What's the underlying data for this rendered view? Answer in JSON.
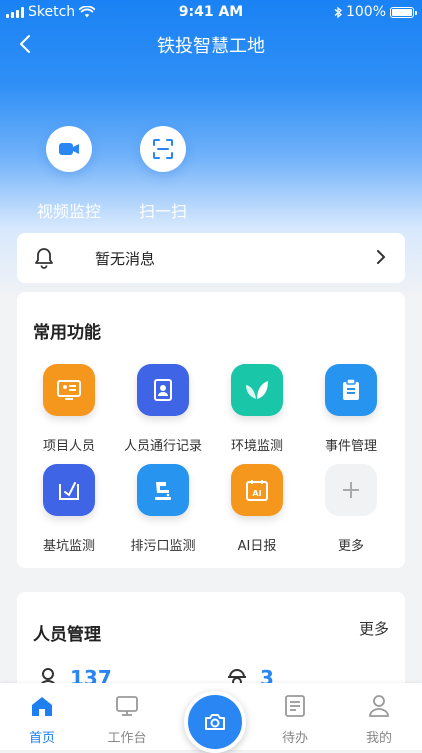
{
  "status": {
    "carrier": "Sketch",
    "time": "9:41 AM",
    "battery": "100%"
  },
  "header": {
    "title": "铁投智慧工地"
  },
  "quick_actions": [
    {
      "label": "视频监控",
      "icon": "video-camera-icon"
    },
    {
      "label": "扫一扫",
      "icon": "scan-icon"
    }
  ],
  "notice": {
    "text": "暂无消息"
  },
  "common": {
    "title": "常用功能",
    "items": [
      {
        "label": "项目人员",
        "icon": "project-staff-icon",
        "color": "#f5961d"
      },
      {
        "label": "人员通行记录",
        "icon": "access-record-icon",
        "color": "#3f64e6"
      },
      {
        "label": "环境监测",
        "icon": "leaf-icon",
        "color": "#19c6a7"
      },
      {
        "label": "事件管理",
        "icon": "clipboard-icon",
        "color": "#2795f0"
      },
      {
        "label": "基坑监测",
        "icon": "foundation-pit-icon",
        "color": "#3f64e6"
      },
      {
        "label": "排污口监测",
        "icon": "outfall-icon",
        "color": "#2795f0"
      },
      {
        "label": "AI日报",
        "icon": "ai-calendar-icon",
        "color": "#f5961d"
      },
      {
        "label": "更多",
        "icon": "plus-icon",
        "color": "#f1f2f4"
      }
    ]
  },
  "personnel": {
    "title": "人员管理",
    "more": "更多",
    "stats": [
      {
        "value": "137",
        "icon": "person-icon"
      },
      {
        "value": "3",
        "icon": "helmet-worker-icon"
      }
    ]
  },
  "tabs": [
    {
      "label": "首页",
      "icon": "home-icon"
    },
    {
      "label": "工作台",
      "icon": "monitor-icon"
    },
    {
      "label": "待办",
      "icon": "list-icon"
    },
    {
      "label": "我的",
      "icon": "user-icon"
    }
  ],
  "colors": {
    "primary": "#2a86f3",
    "active_tab": "#1d7ff0"
  }
}
